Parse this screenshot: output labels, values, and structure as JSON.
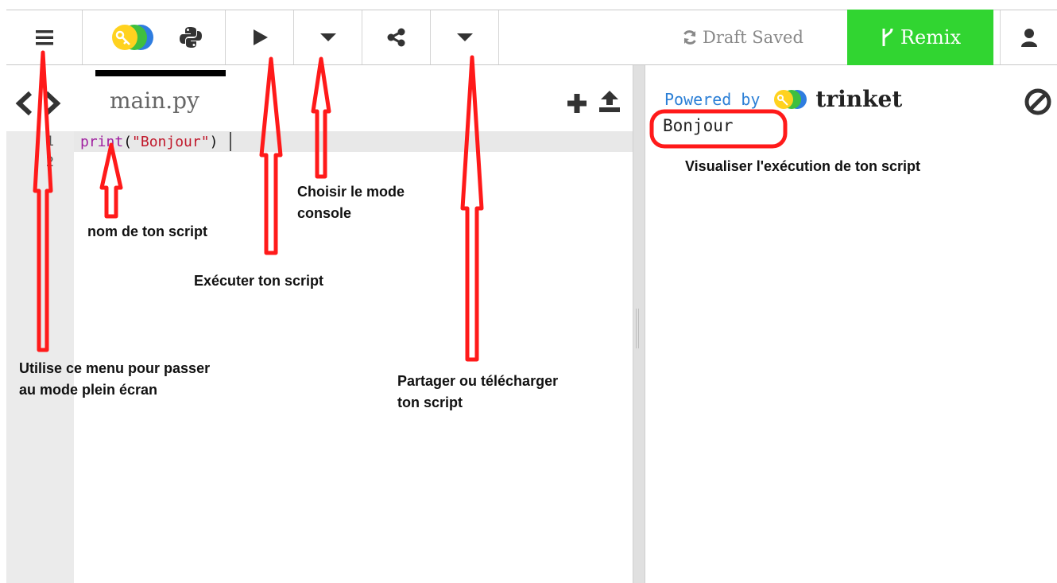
{
  "toolbar": {
    "draft_status": "Draft Saved",
    "remix_label": "Remix",
    "icons": [
      "menu-icon",
      "trinket-logo-icon",
      "python-icon",
      "play-icon",
      "caret-down-icon",
      "share-icon",
      "caret-down-icon",
      "refresh-icon",
      "fork-icon",
      "user-icon"
    ]
  },
  "editor": {
    "filename": "main.py",
    "line_numbers": [
      "1",
      "2"
    ],
    "code_line1": {
      "fn": "print",
      "open": "(",
      "str": "\"Bonjour\"",
      "close": ")"
    }
  },
  "output": {
    "powered_by": "Powered by",
    "brand": "trinket",
    "console_text": "Bonjour"
  },
  "annotations": {
    "menu_note_1": "Utilise ce menu pour passer",
    "menu_note_2": "au mode plein écran",
    "filename_note": "nom de ton script",
    "run_note": "Exécuter ton script",
    "mode_note_1": "Choisir le mode",
    "mode_note_2": "console",
    "share_note_1": "Partager ou télécharger",
    "share_note_2": "ton script",
    "output_note": "Visualiser l'exécution de ton script"
  },
  "colors": {
    "remix": "#31d531",
    "annotation_red": "#ff1a1a",
    "powered_blue": "#2b7fd6",
    "code_keyword": "#a020a0",
    "code_string": "#c0182b"
  }
}
